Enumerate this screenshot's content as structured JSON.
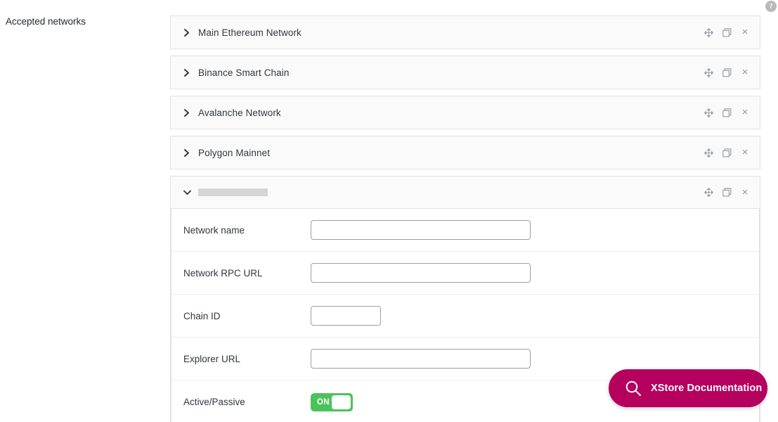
{
  "page": {
    "left_label": "Accepted networks",
    "help_icon": "question-mark-help-icon"
  },
  "colors": {
    "toggle_on": "#4cc35a",
    "docs_pill": "#b5005e",
    "panel_bg": "#fafafa",
    "panel_border": "#e2e2e2",
    "text": "#32373c"
  },
  "row_actions": {
    "move_label": "move",
    "duplicate_label": "duplicate",
    "close_label": "×"
  },
  "networks": [
    {
      "title": "Main Ethereum Network",
      "expanded": false,
      "placeholder_title": false
    },
    {
      "title": "Binance Smart Chain",
      "expanded": false,
      "placeholder_title": false
    },
    {
      "title": "Avalanche Network",
      "expanded": false,
      "placeholder_title": false
    },
    {
      "title": "Polygon Mainnet",
      "expanded": false,
      "placeholder_title": false
    },
    {
      "title": "",
      "expanded": true,
      "placeholder_title": true
    }
  ],
  "form": {
    "fields": [
      {
        "label": "Network name",
        "type": "text",
        "value": "",
        "placeholder": "",
        "size": "wide"
      },
      {
        "label": "Network RPC URL",
        "type": "text",
        "value": "",
        "placeholder": "",
        "size": "wide"
      },
      {
        "label": "Chain ID",
        "type": "text",
        "value": "",
        "placeholder": "",
        "size": "narrow"
      },
      {
        "label": "Explorer URL",
        "type": "text",
        "value": "",
        "placeholder": "",
        "size": "wide"
      },
      {
        "label": "Active/Passive",
        "type": "toggle",
        "value": "ON"
      }
    ]
  },
  "docs_button": {
    "label": "XStore Documentation",
    "icon": "search-icon"
  }
}
